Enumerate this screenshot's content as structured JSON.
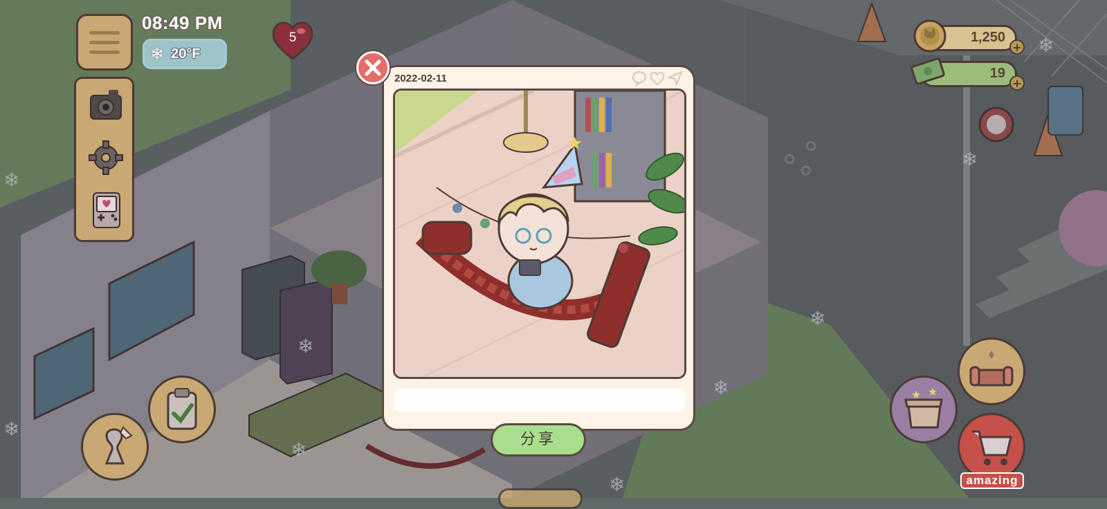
{
  "hud": {
    "time": "08:49 PM",
    "temperature": "20°F",
    "weather_icon": "snowflake-icon",
    "hearts": "5"
  },
  "currency": {
    "coins": "1,250",
    "cash": "19"
  },
  "photo": {
    "date": "2022-02-11",
    "caption_placeholder": ""
  },
  "buttons": {
    "share": "分享",
    "close": "×",
    "shop_badge": "amazing"
  },
  "colors": {
    "accent_panel": "#c9a873",
    "outline": "#4b3a36",
    "share_green": "#a9de8c",
    "close_red": "#e36e6a",
    "card_bg": "#fdf3e7"
  }
}
